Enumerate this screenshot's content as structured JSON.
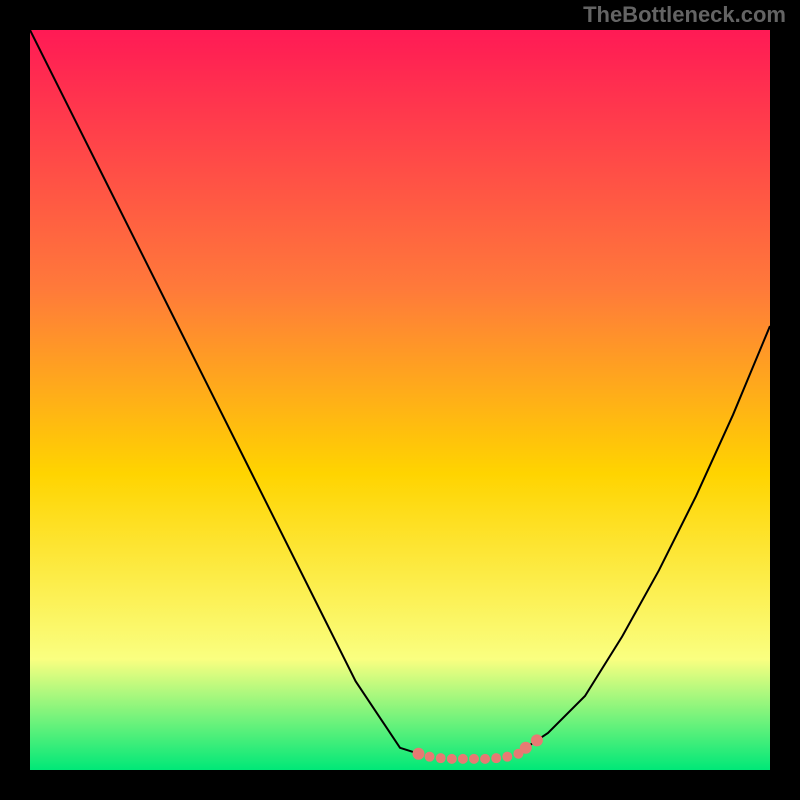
{
  "watermark": "TheBottleneck.com",
  "chart_data": {
    "type": "line",
    "title": "",
    "xlabel": "",
    "ylabel": "",
    "xlim": [
      0,
      100
    ],
    "ylim": [
      0,
      100
    ],
    "grid": false,
    "legend": false,
    "background_gradient": {
      "top": "#ff1a55",
      "upper_mid": "#ff7a3a",
      "mid": "#ffd400",
      "lower": "#faff80",
      "bottom": "#00e878"
    },
    "series": [
      {
        "name": "left-curve",
        "x": [
          0,
          10,
          20,
          30,
          40,
          44,
          48,
          50,
          52.5
        ],
        "y": [
          100,
          80,
          60,
          40,
          20,
          12,
          6,
          3,
          2.2
        ]
      },
      {
        "name": "right-curve",
        "x": [
          67,
          70,
          75,
          80,
          85,
          90,
          95,
          100
        ],
        "y": [
          3,
          5,
          10,
          18,
          27,
          37,
          48,
          60
        ]
      }
    ],
    "flat_bottom_markers": {
      "name": "bottom-dots",
      "color": "#e77a73",
      "x": [
        52.5,
        54,
        55.5,
        57,
        58.5,
        60,
        61.5,
        63,
        64.5,
        66,
        67,
        68.5
      ],
      "y": [
        2.2,
        1.8,
        1.6,
        1.5,
        1.5,
        1.5,
        1.5,
        1.6,
        1.8,
        2.2,
        3,
        4
      ],
      "radius_px": [
        6,
        5,
        5,
        5,
        5,
        5,
        5,
        5,
        5,
        5,
        6,
        6
      ]
    }
  }
}
